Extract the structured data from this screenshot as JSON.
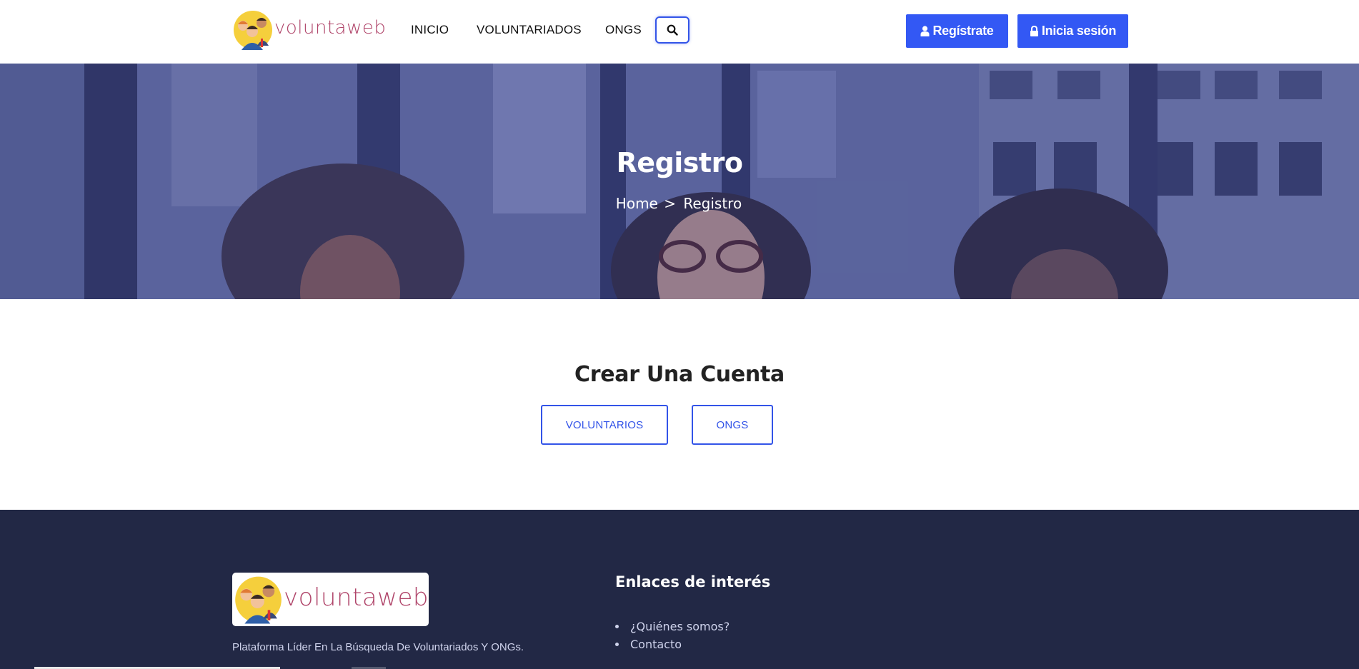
{
  "header": {
    "logo_text": "voluntaweb",
    "nav": [
      {
        "label": "INICIO"
      },
      {
        "label": "VOLUNTARIADOS"
      },
      {
        "label": "ONGS"
      }
    ],
    "search_icon": "search-icon",
    "register_label": "Regístrate",
    "login_label": "Inicia sesión",
    "accent": "#3358f4"
  },
  "hero": {
    "title": "Registro",
    "breadcrumb": {
      "home": "Home",
      "separator": ">",
      "current": "Registro"
    }
  },
  "main": {
    "title": "Crear Una Cuenta",
    "buttons": [
      {
        "label": "VOLUNTARIOS"
      },
      {
        "label": "ONGS"
      }
    ]
  },
  "footer": {
    "logo_text": "voluntaweb",
    "tagline": "Plataforma Líder En La Búsqueda De Voluntariados Y ONGs.",
    "links_heading": "Enlaces de interés",
    "links": [
      {
        "label": "¿Quiénes somos?"
      },
      {
        "label": "Contacto"
      }
    ],
    "background": "#222845"
  }
}
